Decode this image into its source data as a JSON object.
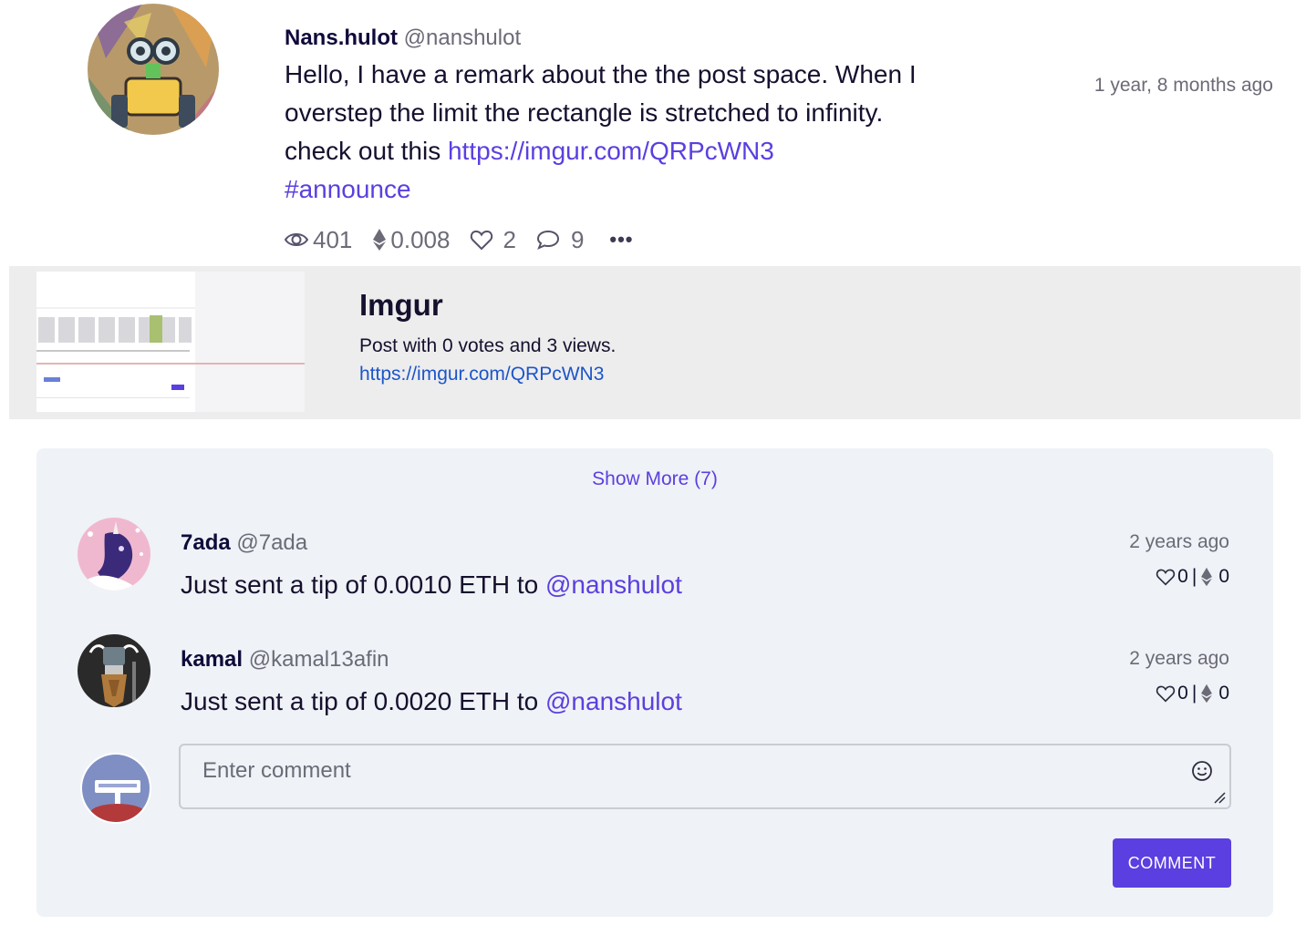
{
  "post": {
    "author_name": "Nans.hulot",
    "author_handle": "@nanshulot",
    "time": "1 year, 8 months ago",
    "text_line1": "Hello, I have a remark about the the post space. When I",
    "text_line2": "overstep the limit the rectangle is stretched to infinity.",
    "text_line3_prefix": "check out this",
    "link": "https://imgur.com/QRPcWN3",
    "hashtag": "#announce",
    "stats": {
      "views": "401",
      "eth": "0.008",
      "likes": "2",
      "comments": "9",
      "more_label": "•••"
    }
  },
  "link_preview": {
    "title": "Imgur",
    "description": "Post with 0 votes and 3 views.",
    "url": "https://imgur.com/QRPcWN3"
  },
  "comments": {
    "show_more_label": "Show More (7)",
    "items": [
      {
        "name": "7ada",
        "handle": "@7ada",
        "text_prefix": "Just sent a tip of 0.0010 ETH to",
        "mention": "@nanshulot",
        "time": "2 years ago",
        "likes": "0",
        "separator": "|",
        "eth": "0"
      },
      {
        "name": "kamal",
        "handle": "@kamal13afin",
        "text_prefix": "Just sent a tip of 0.0020 ETH to",
        "mention": "@nanshulot",
        "time": "2 years ago",
        "likes": "0",
        "separator": "|",
        "eth": "0"
      }
    ],
    "input_placeholder": "Enter comment",
    "submit_label": "COMMENT"
  },
  "colors": {
    "accent": "#5b3fe0",
    "link_blue": "#1c55c9",
    "muted": "#6b6b78",
    "panel_bg": "#eff2f6",
    "card_bg": "#ededed"
  },
  "icons": [
    "eye-icon",
    "ethereum-icon",
    "heart-icon",
    "chat-bubble-icon",
    "more-dots-icon",
    "emoji-smile-icon",
    "resize-handle-icon"
  ]
}
